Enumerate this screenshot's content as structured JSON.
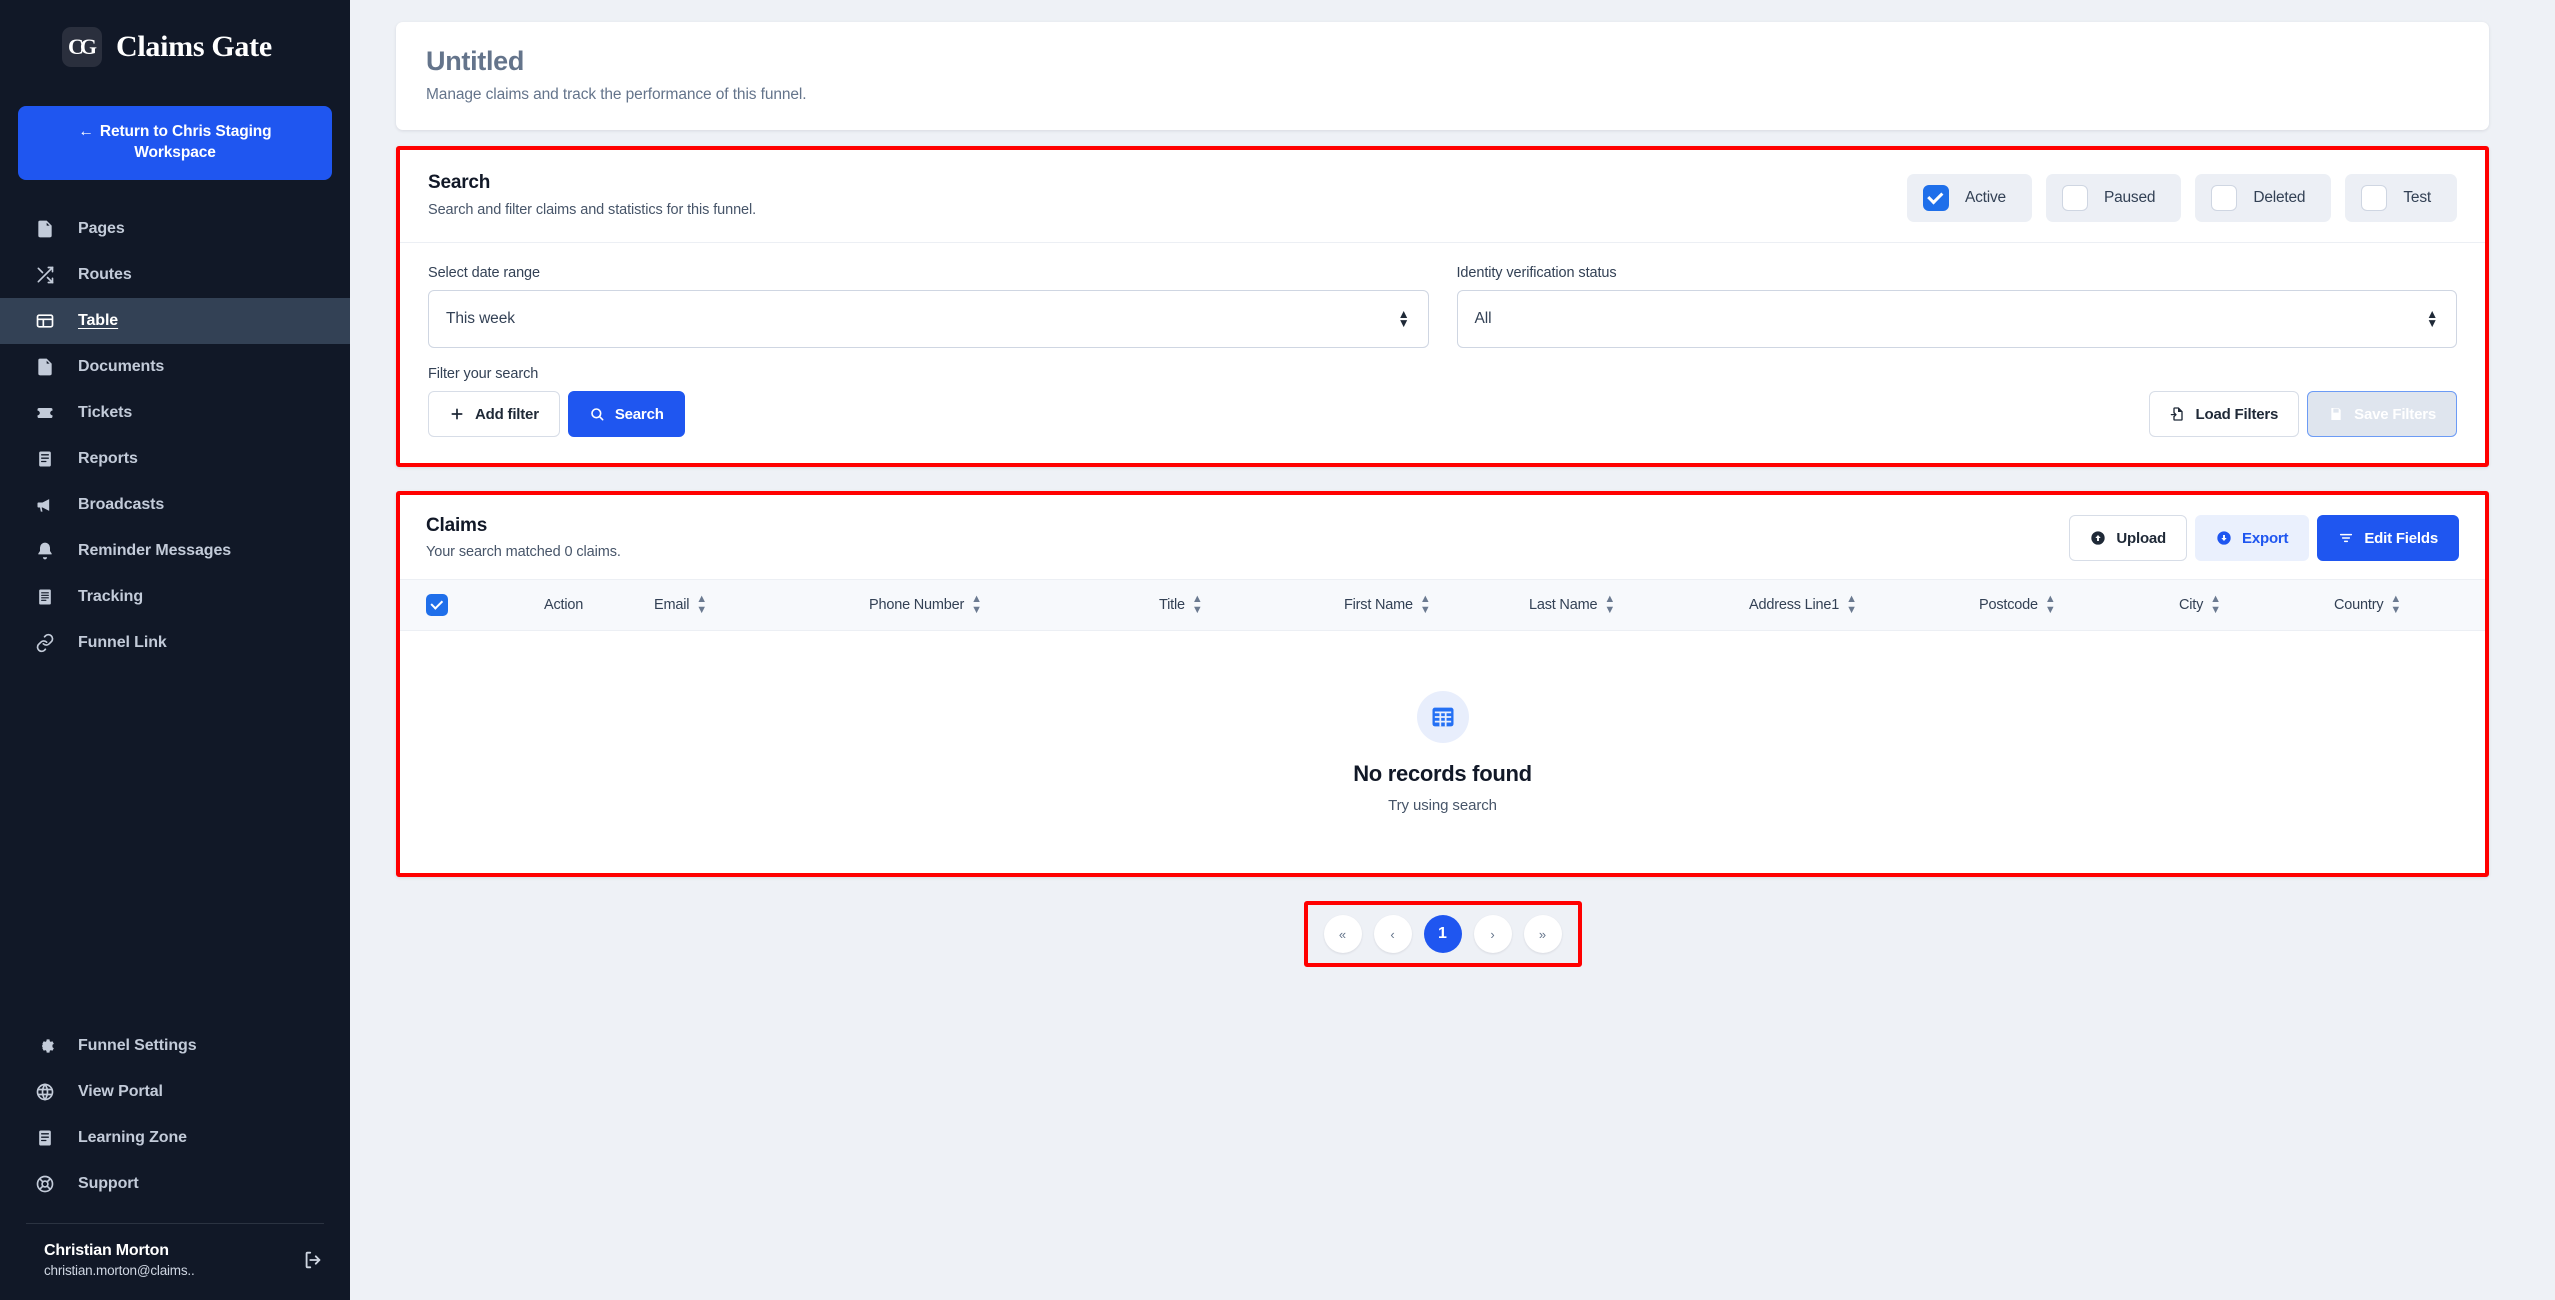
{
  "brand": {
    "logo_text": "CG",
    "name": "Claims Gate",
    "logo_icon": "claims-gate-logo-icon"
  },
  "sidebar": {
    "return_button": {
      "arrow": "←",
      "label": "Return to Chris Staging Workspace"
    },
    "items": [
      {
        "label": "Pages",
        "icon": "file-icon",
        "active": false
      },
      {
        "label": "Routes",
        "icon": "shuffle-icon",
        "active": false
      },
      {
        "label": "Table",
        "icon": "table-icon",
        "active": true
      },
      {
        "label": "Documents",
        "icon": "document-icon",
        "active": false
      },
      {
        "label": "Tickets",
        "icon": "ticket-icon",
        "active": false
      },
      {
        "label": "Reports",
        "icon": "report-icon",
        "active": false
      },
      {
        "label": "Broadcasts",
        "icon": "megaphone-icon",
        "active": false
      },
      {
        "label": "Reminder Messages",
        "icon": "bell-icon",
        "active": false
      },
      {
        "label": "Tracking",
        "icon": "tracking-icon",
        "active": false
      },
      {
        "label": "Funnel Link",
        "icon": "link-icon",
        "active": false
      }
    ],
    "bottom_items": [
      {
        "label": "Funnel Settings",
        "icon": "gear-icon"
      },
      {
        "label": "View Portal",
        "icon": "globe-icon"
      },
      {
        "label": "Learning Zone",
        "icon": "book-icon"
      },
      {
        "label": "Support",
        "icon": "lifebuoy-icon"
      }
    ],
    "user": {
      "name": "Christian Morton",
      "email": "christian.morton@claims..",
      "logout_icon": "logout-icon"
    }
  },
  "page": {
    "title": "Untitled",
    "subtitle": "Manage claims and track the performance of this funnel."
  },
  "search": {
    "title": "Search",
    "subtitle": "Search and filter claims and statistics for this funnel.",
    "status_filters": [
      {
        "label": "Active",
        "checked": true
      },
      {
        "label": "Paused",
        "checked": false
      },
      {
        "label": "Deleted",
        "checked": false
      },
      {
        "label": "Test",
        "checked": false
      }
    ],
    "date_range": {
      "label": "Select date range",
      "value": "This week"
    },
    "identity_status": {
      "label": "Identity verification status",
      "value": "All"
    },
    "filter_label": "Filter your search",
    "add_filter_label": "Add filter",
    "add_filter_icon": "plus-icon",
    "search_label": "Search",
    "search_icon": "search-icon",
    "load_filters_label": "Load Filters",
    "load_filters_icon": "file-import-icon",
    "save_filters_label": "Save Filters",
    "save_filters_icon": "save-icon",
    "save_filters_disabled": true
  },
  "claims": {
    "title": "Claims",
    "subtitle": "Your search matched 0 claims.",
    "upload_label": "Upload",
    "upload_icon": "upload-circle-icon",
    "export_label": "Export",
    "export_icon": "download-circle-icon",
    "edit_fields_label": "Edit Fields",
    "edit_fields_icon": "sliders-icon",
    "select_all_checked": true,
    "columns": [
      {
        "label": "Action",
        "sortable": false
      },
      {
        "label": "Email",
        "sortable": true
      },
      {
        "label": "Phone Number",
        "sortable": true
      },
      {
        "label": "Title",
        "sortable": true
      },
      {
        "label": "First Name",
        "sortable": true
      },
      {
        "label": "Last Name",
        "sortable": true
      },
      {
        "label": "Address Line1",
        "sortable": true
      },
      {
        "label": "Postcode",
        "sortable": true
      },
      {
        "label": "City",
        "sortable": true
      },
      {
        "label": "Country",
        "sortable": true
      }
    ],
    "rows": [],
    "empty": {
      "icon": "table-grid-icon",
      "title": "No records found",
      "subtitle": "Try using search"
    }
  },
  "pagination": {
    "first_label": "«",
    "prev_label": "‹",
    "current_page": "1",
    "next_label": "›",
    "last_label": "»"
  },
  "colors": {
    "accent_blue": "#1f56f0",
    "checkbox_blue": "#1f6fea",
    "sidebar_bg": "#111827",
    "sidebar_active": "#334155",
    "page_bg": "#eef1f6",
    "highlight_outline": "#ff0000"
  }
}
